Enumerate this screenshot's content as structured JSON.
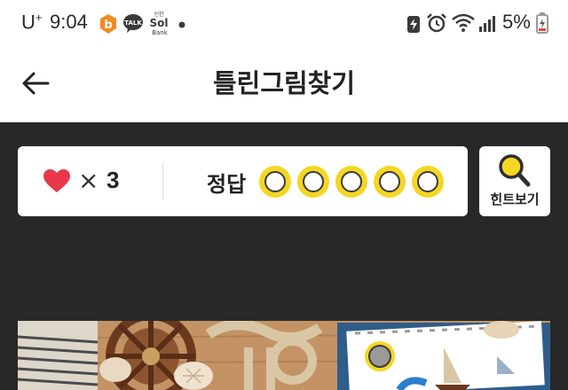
{
  "status_bar": {
    "carrier": "U",
    "carrier_sup": "+",
    "time": "9:04",
    "battery_percent": "5%"
  },
  "header": {
    "title": "틀린그림찾기",
    "back_icon": "arrow-left-icon"
  },
  "game": {
    "lives_symbol": "×",
    "lives": "3",
    "answer_label": "정답",
    "answers_found": 0,
    "answers_total": 5
  },
  "hint": {
    "label": "힌트보기",
    "icon": "magnifier-icon"
  },
  "colors": {
    "heart": "#e8374a",
    "accent_yellow": "#f5d623",
    "background": "#282828"
  }
}
